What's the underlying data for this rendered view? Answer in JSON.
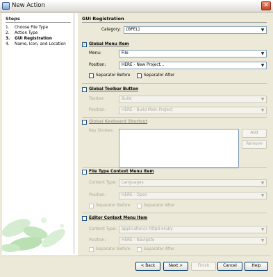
{
  "window": {
    "title": "New Action",
    "close_glyph": "✕"
  },
  "steps": {
    "heading": "Steps",
    "items": [
      {
        "num": "1.",
        "label": "Choose File Type"
      },
      {
        "num": "2.",
        "label": "Action Type"
      },
      {
        "num": "3.",
        "label": "GUI Registration"
      },
      {
        "num": "4.",
        "label": "Name, Icon, and Location"
      }
    ]
  },
  "content": {
    "heading": "GUI Registration",
    "category": {
      "label": "Category:",
      "value": "[BPEL]"
    },
    "global_menu": {
      "label": "Global Menu Item",
      "checked": "✓",
      "menu_label": "Menu:",
      "menu_value": "File",
      "position_label": "Position:",
      "position_value": "HERE - New Project...",
      "sep_before": "Separator Before",
      "sep_after": "Separator After"
    },
    "global_toolbar": {
      "label": "Global Toolbar Button",
      "toolbar_label": "Toolbar:",
      "toolbar_value": "Build",
      "position_label": "Position:",
      "position_value": "HERE - Build Main Project"
    },
    "global_keyboard": {
      "label": "Global Keyboard Shortcut",
      "keystrokes_label": "Key Strokes:",
      "add_label": "Add",
      "remove_label": "Remove"
    },
    "file_type_menu": {
      "label": "File Type Context Menu Item",
      "content_type_label": "Content Type:",
      "content_type_value": "Languages",
      "position_label": "Position:",
      "position_value": "HERE - Open",
      "sep_before": "Separator Before",
      "sep_after": "Separator After"
    },
    "editor_menu": {
      "label": "Editor Context Menu Item",
      "content_type_label": "Content Type:",
      "content_type_value": "application/x-httpd-eruby",
      "position_label": "Position:",
      "position_value": "HERE - Navigate",
      "sep_before": "Separator Before",
      "sep_after": "Separator After"
    }
  },
  "footer": {
    "back": "< Back",
    "next": "Next >",
    "finish": "Finish",
    "cancel": "Cancel",
    "help": "Help"
  },
  "icons": {
    "dropdown": "▼"
  }
}
